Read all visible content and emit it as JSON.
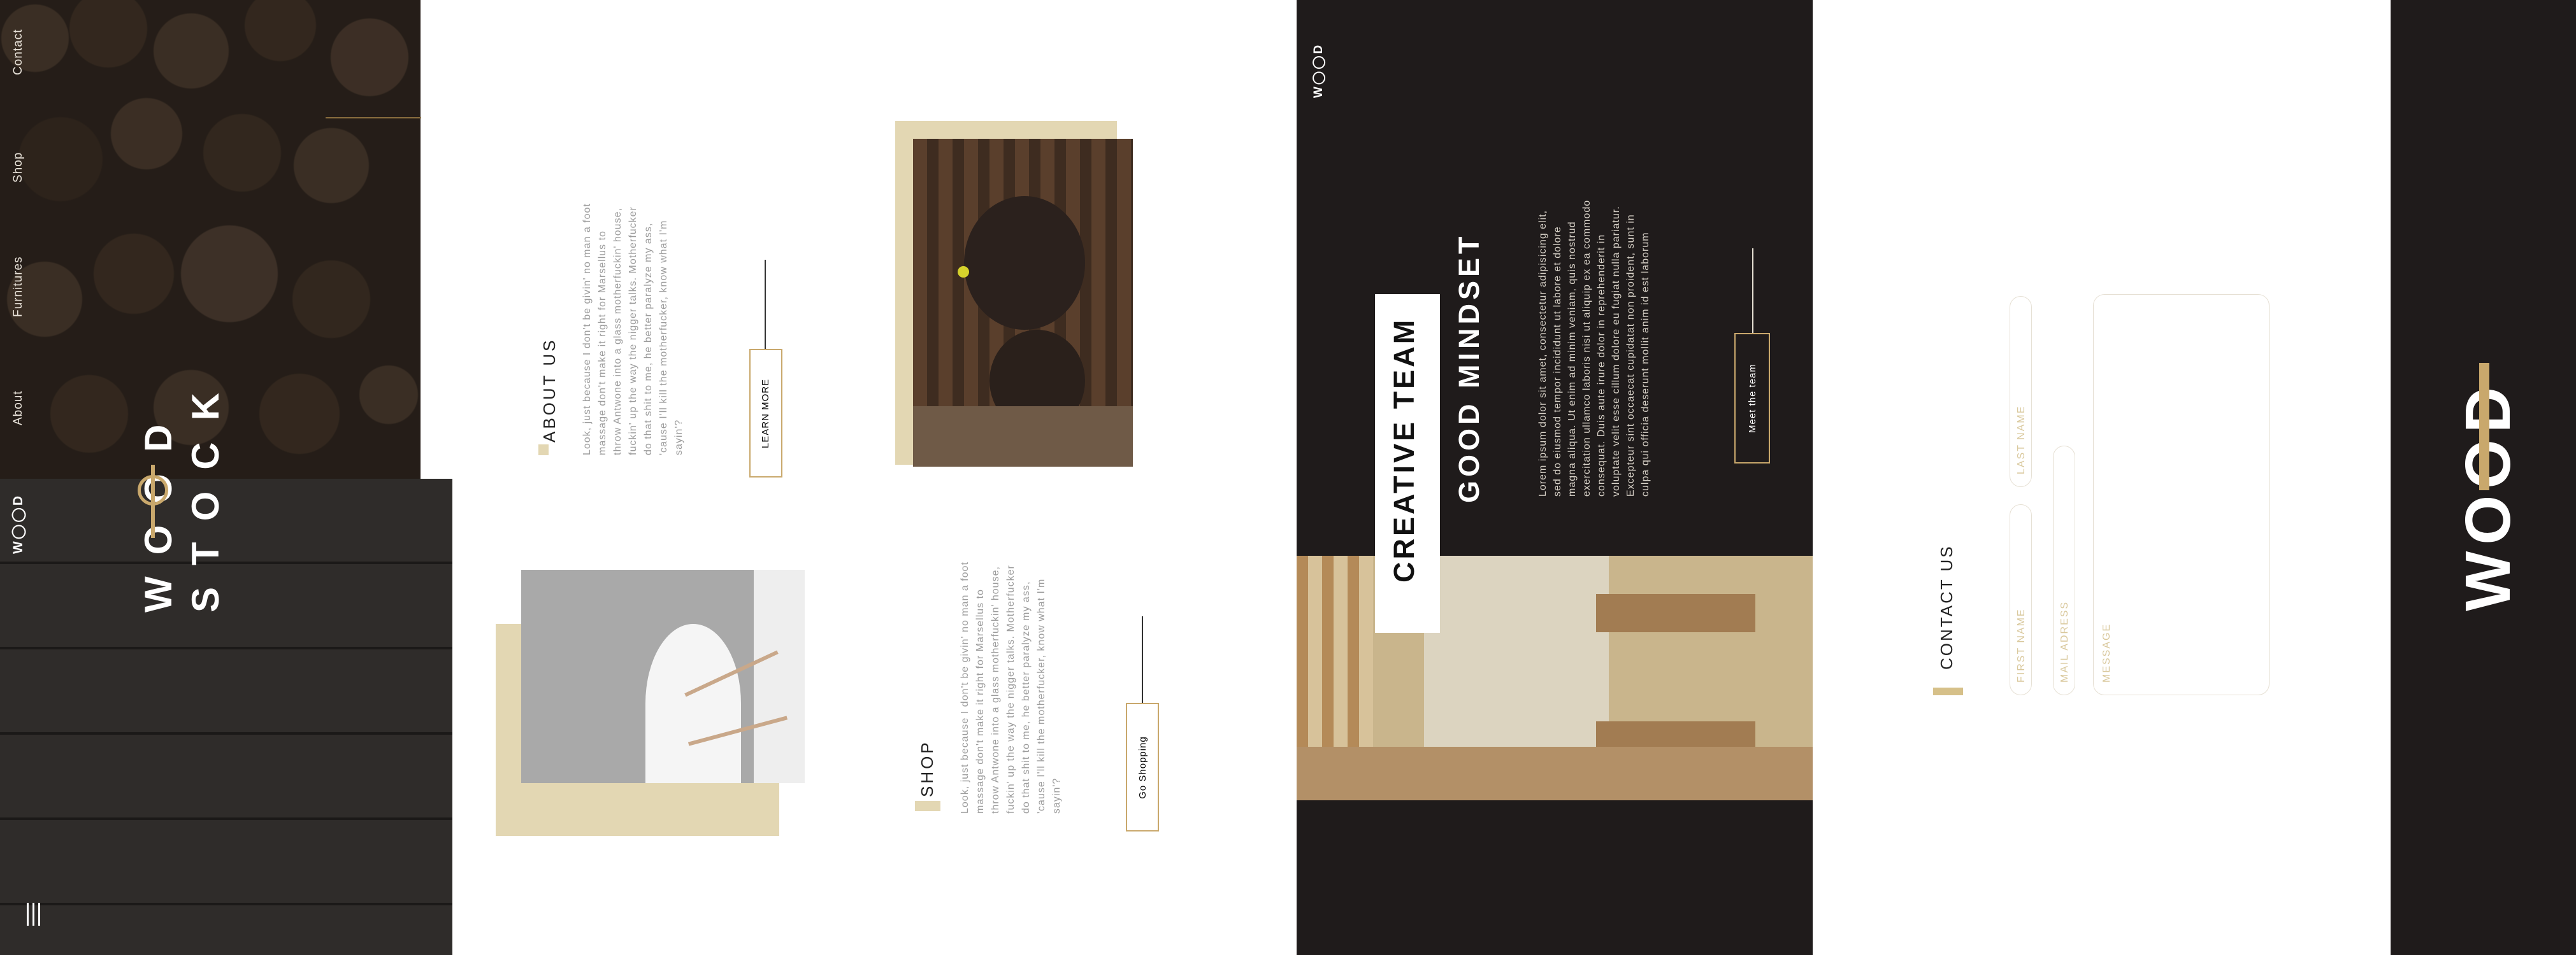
{
  "colors": {
    "accent": "#c9a86c",
    "beige": "#e3d7b3",
    "dark": "#1f1b1b"
  },
  "sidebar": {
    "nav": [
      {
        "label": "Contact"
      },
      {
        "label": "Shop"
      },
      {
        "label": "Furnitures"
      },
      {
        "label": "About"
      }
    ],
    "logo": "W◯◯D",
    "menu_icon": "menu-icon"
  },
  "hero": {
    "line1": "WOOD",
    "line2": "STOCK"
  },
  "about": {
    "title": "ABOUT US",
    "text": [
      "Look, just because I don't be givin' no man a foot",
      "massage don't make it right for Marsellus to",
      "throw Antwone into a glass motherfuckin' house,",
      "fuckin' up the way the nigger talks. Motherfucker",
      "do that shit to me, he better paralyze my ass,",
      "'cause I'll kill the motherfucker, know what I'm",
      "sayin'?"
    ],
    "button": "LEARN MORE"
  },
  "shop": {
    "title": "SHOP",
    "text": [
      "Look, just because I don't be givin' no man a foot",
      "massage don't make it right for Marsellus to",
      "throw Antwone into a glass motherfuckin' house,",
      "fuckin' up the way the nigger talks. Motherfucker",
      "do that shit to me, he better paralyze my ass,",
      "'cause I'll kill the motherfucker, know what I'm",
      "sayin'?"
    ],
    "button": "Go Shopping"
  },
  "team": {
    "logo": "W◯◯D",
    "title": "CREATIVE TEAM",
    "subtitle": "GOOD MINDSET",
    "text": [
      "Lorem ipsum dolor sit amet, consectetur adipisicing elit,",
      "sed do eiusmod tempor incididunt ut labore et dolore",
      "magna aliqua. Ut enim ad minim veniam, quis nostrud",
      "exercitation ullamco laboris nisi ut aliquip ex ea commodo",
      "consequat. Duis aute irure dolor in reprehenderit in",
      "voluptate velit esse cillum dolore eu fugiat nulla pariatur.",
      "Excepteur sint occaecat cupidatat non proident, sunt in",
      "culpa qui officia deserunt mollit anim id est laborum"
    ],
    "button": "Meet the team"
  },
  "contact": {
    "title": "CONTACT US",
    "first_name": "FIRST NAME",
    "last_name": "LAST NAME",
    "mail": "MAIL ADRESS",
    "message": "MESSAGE"
  },
  "footer": {
    "logo": "WOOD"
  }
}
